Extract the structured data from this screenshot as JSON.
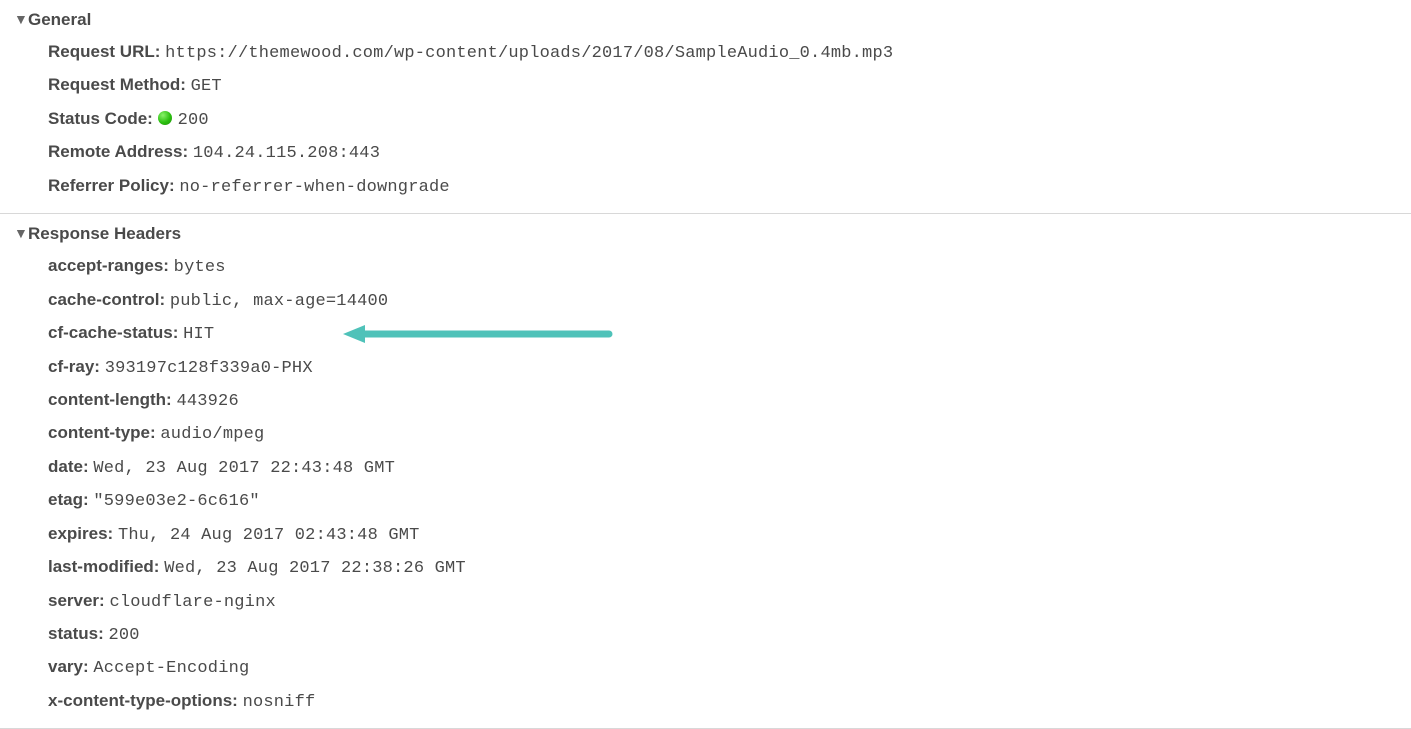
{
  "general": {
    "title": "General",
    "items": [
      {
        "label": "Request URL:",
        "value": "https://themewood.com/wp-content/uploads/2017/08/SampleAudio_0.4mb.mp3"
      },
      {
        "label": "Request Method:",
        "value": "GET"
      },
      {
        "label": "Status Code:",
        "value": "200",
        "statusDot": true
      },
      {
        "label": "Remote Address:",
        "value": "104.24.115.208:443"
      },
      {
        "label": "Referrer Policy:",
        "value": "no-referrer-when-downgrade"
      }
    ]
  },
  "responseHeaders": {
    "title": "Response Headers",
    "items": [
      {
        "label": "accept-ranges:",
        "value": "bytes"
      },
      {
        "label": "cache-control:",
        "value": "public, max-age=14400"
      },
      {
        "label": "cf-cache-status:",
        "value": "HIT",
        "highlighted": true
      },
      {
        "label": "cf-ray:",
        "value": "393197c128f339a0-PHX"
      },
      {
        "label": "content-length:",
        "value": "443926"
      },
      {
        "label": "content-type:",
        "value": "audio/mpeg"
      },
      {
        "label": "date:",
        "value": "Wed, 23 Aug 2017 22:43:48 GMT"
      },
      {
        "label": "etag:",
        "value": "\"599e03e2-6c616\""
      },
      {
        "label": "expires:",
        "value": "Thu, 24 Aug 2017 02:43:48 GMT"
      },
      {
        "label": "last-modified:",
        "value": "Wed, 23 Aug 2017 22:38:26 GMT"
      },
      {
        "label": "server:",
        "value": "cloudflare-nginx"
      },
      {
        "label": "status:",
        "value": "200"
      },
      {
        "label": "vary:",
        "value": "Accept-Encoding"
      },
      {
        "label": "x-content-type-options:",
        "value": "nosniff"
      }
    ]
  },
  "arrowColor": "#4fc2b9"
}
